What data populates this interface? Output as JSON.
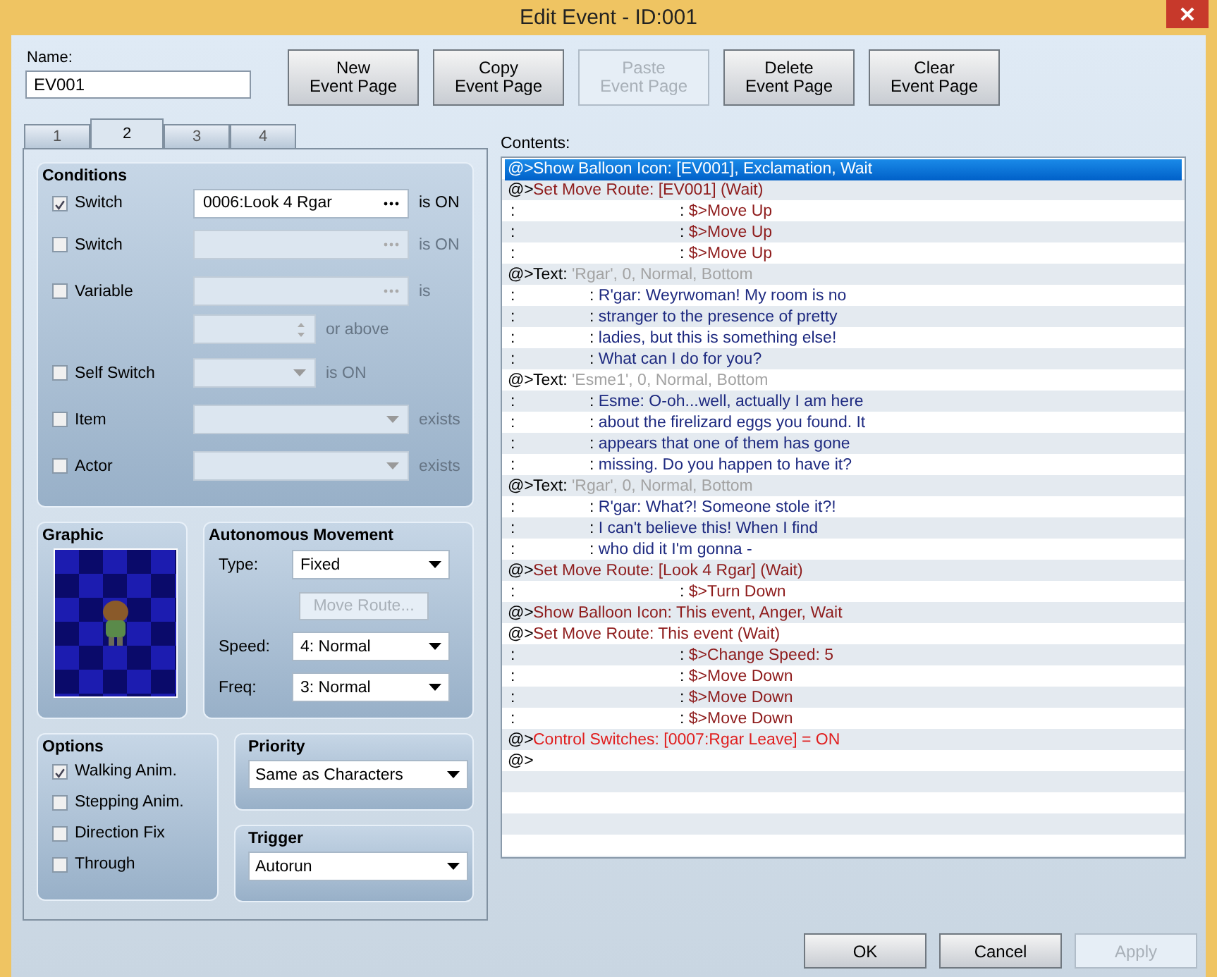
{
  "window": {
    "title": "Edit Event - ID:001"
  },
  "name": {
    "label": "Name:",
    "value": "EV001"
  },
  "page_buttons": [
    {
      "label": "New\nEvent Page",
      "disabled": false
    },
    {
      "label": "Copy\nEvent Page",
      "disabled": false
    },
    {
      "label": "Paste\nEvent Page",
      "disabled": true
    },
    {
      "label": "Delete\nEvent Page",
      "disabled": false
    },
    {
      "label": "Clear\nEvent Page",
      "disabled": false
    }
  ],
  "tabs": [
    {
      "label": "1",
      "selected": false
    },
    {
      "label": "2",
      "selected": true
    },
    {
      "label": "3",
      "selected": false
    },
    {
      "label": "4",
      "selected": false
    }
  ],
  "conditions": {
    "title": "Conditions",
    "rows": [
      {
        "kind": "picker",
        "label": "Switch",
        "checked": true,
        "value": "0006:Look 4 Rgar",
        "suffix": "is ON"
      },
      {
        "kind": "picker",
        "label": "Switch",
        "checked": false,
        "suffix": "is ON"
      },
      {
        "kind": "picker",
        "label": "Variable",
        "checked": false,
        "suffix": "is"
      },
      {
        "kind": "spin",
        "checked": false,
        "suffix": "or above"
      },
      {
        "kind": "short-dropdown",
        "label": "Self Switch",
        "checked": false,
        "suffix": "is ON"
      },
      {
        "kind": "dropdown",
        "label": "Item",
        "checked": false,
        "suffix": "exists"
      },
      {
        "kind": "dropdown",
        "label": "Actor",
        "checked": false,
        "suffix": "exists"
      }
    ]
  },
  "graphic": {
    "title": "Graphic"
  },
  "movement": {
    "title": "Autonomous Movement",
    "type_label": "Type:",
    "type": "Fixed",
    "route_button": {
      "label": "Move Route...",
      "disabled": true
    },
    "speed_label": "Speed:",
    "speed": "4: Normal",
    "freq_label": "Freq:",
    "freq": "3: Normal"
  },
  "options": {
    "title": "Options",
    "items": [
      {
        "label": "Walking Anim.",
        "checked": true
      },
      {
        "label": "Stepping Anim.",
        "checked": false
      },
      {
        "label": "Direction Fix",
        "checked": false
      },
      {
        "label": "Through",
        "checked": false
      }
    ]
  },
  "priority": {
    "title": "Priority",
    "value": "Same as Characters"
  },
  "trigger": {
    "title": "Trigger",
    "value": "Autorun"
  },
  "contents": {
    "label": "Contents:",
    "lines": [
      {
        "kind": "command",
        "selected": true,
        "lead": "@>",
        "segments": [
          {
            "text": "Show Balloon Icon: [EV001], Exclamation, Wait",
            "kind": "command"
          }
        ]
      },
      {
        "kind": "command",
        "selected": false,
        "lead": "@>",
        "segments": [
          {
            "text": "Set Move Route: [EV001] (Wait)",
            "kind": "command"
          }
        ]
      },
      {
        "kind": "route",
        "selected": false,
        "lead": ":",
        "segments": [
          {
            "text": ": ",
            "kind": "plain"
          },
          {
            "text": "$>Move Up",
            "kind": "command"
          }
        ]
      },
      {
        "kind": "route",
        "selected": false,
        "lead": ":",
        "segments": [
          {
            "text": ": ",
            "kind": "plain"
          },
          {
            "text": "$>Move Up",
            "kind": "command"
          }
        ]
      },
      {
        "kind": "route",
        "selected": false,
        "lead": ":",
        "segments": [
          {
            "text": ": ",
            "kind": "plain"
          },
          {
            "text": "$>Move Up",
            "kind": "command"
          }
        ]
      },
      {
        "kind": "command",
        "selected": false,
        "lead": "@>",
        "segments": [
          {
            "text": "Text: ",
            "kind": "plain"
          },
          {
            "text": "'Rgar', 0, Normal, Bottom",
            "kind": "args"
          }
        ]
      },
      {
        "kind": "message",
        "selected": false,
        "lead": ":",
        "segments": [
          {
            "text": ": ",
            "kind": "plain"
          },
          {
            "text": "R'gar: Weyrwoman! My room is no",
            "kind": "message"
          }
        ]
      },
      {
        "kind": "message",
        "selected": false,
        "lead": ":",
        "segments": [
          {
            "text": ": ",
            "kind": "plain"
          },
          {
            "text": "stranger to the presence of pretty",
            "kind": "message"
          }
        ]
      },
      {
        "kind": "message",
        "selected": false,
        "lead": ":",
        "segments": [
          {
            "text": ": ",
            "kind": "plain"
          },
          {
            "text": "ladies, but this is something else!",
            "kind": "message"
          }
        ]
      },
      {
        "kind": "message",
        "selected": false,
        "lead": ":",
        "segments": [
          {
            "text": ": ",
            "kind": "plain"
          },
          {
            "text": "What can I do for you?",
            "kind": "message"
          }
        ]
      },
      {
        "kind": "command",
        "selected": false,
        "lead": "@>",
        "segments": [
          {
            "text": "Text: ",
            "kind": "plain"
          },
          {
            "text": "'Esme1', 0, Normal, Bottom",
            "kind": "args"
          }
        ]
      },
      {
        "kind": "message",
        "selected": false,
        "lead": ":",
        "segments": [
          {
            "text": ": ",
            "kind": "plain"
          },
          {
            "text": "Esme: O-oh...well, actually I am here",
            "kind": "message"
          }
        ]
      },
      {
        "kind": "message",
        "selected": false,
        "lead": ":",
        "segments": [
          {
            "text": ": ",
            "kind": "plain"
          },
          {
            "text": "about the firelizard eggs you found. It",
            "kind": "message"
          }
        ]
      },
      {
        "kind": "message",
        "selected": false,
        "lead": ":",
        "segments": [
          {
            "text": ": ",
            "kind": "plain"
          },
          {
            "text": "appears that one of them has gone",
            "kind": "message"
          }
        ]
      },
      {
        "kind": "message",
        "selected": false,
        "lead": ":",
        "segments": [
          {
            "text": ": ",
            "kind": "plain"
          },
          {
            "text": "missing. Do you happen to have it?",
            "kind": "message"
          }
        ]
      },
      {
        "kind": "command",
        "selected": false,
        "lead": "@>",
        "segments": [
          {
            "text": "Text: ",
            "kind": "plain"
          },
          {
            "text": "'Rgar', 0, Normal, Bottom",
            "kind": "args"
          }
        ]
      },
      {
        "kind": "message",
        "selected": false,
        "lead": ":",
        "segments": [
          {
            "text": ": ",
            "kind": "plain"
          },
          {
            "text": "R'gar: What?! Someone stole it?!",
            "kind": "message"
          }
        ]
      },
      {
        "kind": "message",
        "selected": false,
        "lead": ":",
        "segments": [
          {
            "text": ": ",
            "kind": "plain"
          },
          {
            "text": "I can't believe this! When I find",
            "kind": "message"
          }
        ]
      },
      {
        "kind": "message",
        "selected": false,
        "lead": ":",
        "segments": [
          {
            "text": ": ",
            "kind": "plain"
          },
          {
            "text": "who did it I'm gonna -",
            "kind": "message"
          }
        ]
      },
      {
        "kind": "command",
        "selected": false,
        "lead": "@>",
        "segments": [
          {
            "text": "Set Move Route: [Look 4 Rgar] (Wait)",
            "kind": "command"
          }
        ]
      },
      {
        "kind": "route",
        "selected": false,
        "lead": ":",
        "segments": [
          {
            "text": ": ",
            "kind": "plain"
          },
          {
            "text": "$>Turn Down",
            "kind": "command"
          }
        ]
      },
      {
        "kind": "command",
        "selected": false,
        "lead": "@>",
        "segments": [
          {
            "text": "Show Balloon Icon: This event, Anger, Wait",
            "kind": "command"
          }
        ]
      },
      {
        "kind": "command",
        "selected": false,
        "lead": "@>",
        "segments": [
          {
            "text": "Set Move Route: This event (Wait)",
            "kind": "command"
          }
        ]
      },
      {
        "kind": "route",
        "selected": false,
        "lead": ":",
        "segments": [
          {
            "text": ": ",
            "kind": "plain"
          },
          {
            "text": "$>Change Speed: 5",
            "kind": "command"
          }
        ]
      },
      {
        "kind": "route",
        "selected": false,
        "lead": ":",
        "segments": [
          {
            "text": ": ",
            "kind": "plain"
          },
          {
            "text": "$>Move Down",
            "kind": "command"
          }
        ]
      },
      {
        "kind": "route",
        "selected": false,
        "lead": ":",
        "segments": [
          {
            "text": ": ",
            "kind": "plain"
          },
          {
            "text": "$>Move Down",
            "kind": "command"
          }
        ]
      },
      {
        "kind": "route",
        "selected": false,
        "lead": ":",
        "segments": [
          {
            "text": ": ",
            "kind": "plain"
          },
          {
            "text": "$>Move Down",
            "kind": "command"
          }
        ]
      },
      {
        "kind": "command",
        "selected": false,
        "lead": "@>",
        "segments": [
          {
            "text": "Control Switches: [0007:Rgar Leave] = ON",
            "kind": "control"
          }
        ]
      },
      {
        "kind": "command",
        "selected": false,
        "lead": "@>"
      }
    ]
  },
  "dialog_buttons": [
    {
      "label": "OK",
      "disabled": false
    },
    {
      "label": "Cancel",
      "disabled": false
    },
    {
      "label": "Apply",
      "disabled": true
    }
  ]
}
